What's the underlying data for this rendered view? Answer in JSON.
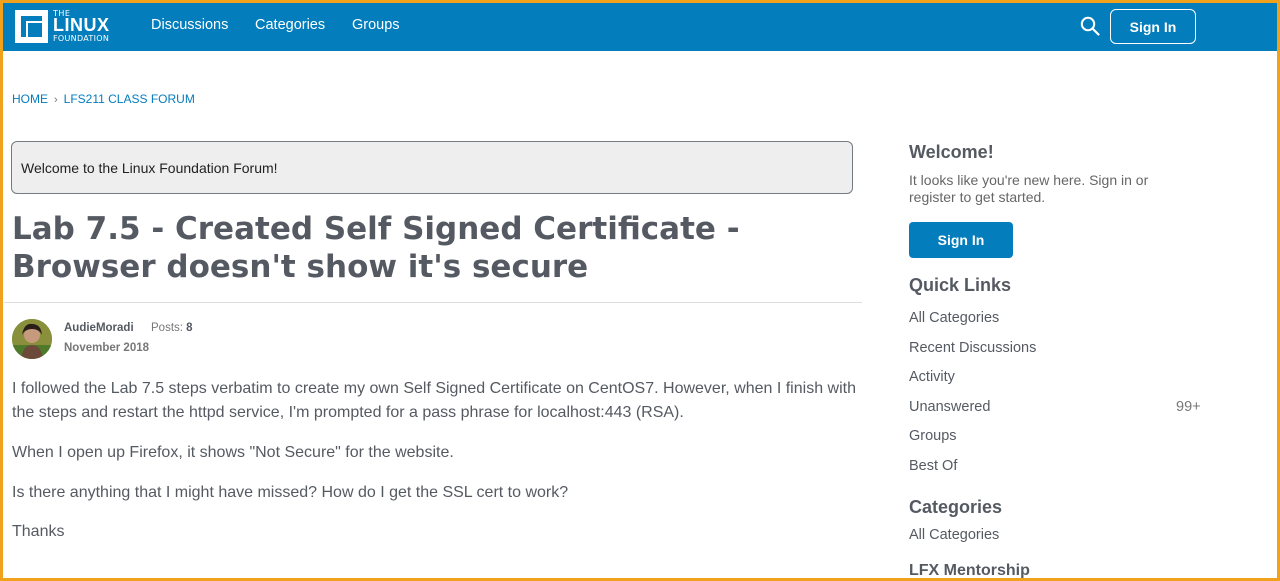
{
  "header": {
    "logo": {
      "the": "THE",
      "linux": "LINUX",
      "foundation": "FOUNDATION"
    },
    "nav": [
      "Discussions",
      "Categories",
      "Groups"
    ],
    "search_icon": "search-icon",
    "signin_label": "Sign In",
    "accent_color": "#037dbc"
  },
  "breadcrumb": {
    "home": "HOME",
    "separator": "›",
    "forum": "LFS211 CLASS FORUM"
  },
  "welcome_banner": "Welcome to the Linux Foundation Forum!",
  "post": {
    "title": "Lab 7.5 - Created Self Signed Certificate - Browser doesn't show it's secure",
    "author": "AudieMoradi",
    "posts_label": "Posts:",
    "posts_count": "8",
    "date": "November 2018",
    "paragraphs": [
      "I followed the Lab 7.5 steps verbatim to create my own Self Signed Certificate on CentOS7. However, when I finish with the steps and restart the httpd service, I'm prompted for a pass phrase for localhost:443 (RSA).",
      "When I open up Firefox, it shows \"Not Secure\" for the website.",
      "Is there anything that I might have missed? How do I get the SSL cert to work?",
      "Thanks"
    ]
  },
  "sidebar": {
    "welcome_heading": "Welcome!",
    "welcome_text": "It looks like you're new here. Sign in or register to get started.",
    "signin_label": "Sign In",
    "quick_links_heading": "Quick Links",
    "quick_links": [
      "All Categories",
      "Recent Discussions",
      "Activity",
      "Unanswered",
      "Groups",
      "Best Of"
    ],
    "unanswered_count": "99+",
    "categories_heading": "Categories",
    "categories": [
      "All Categories",
      "LFX Mentorship"
    ]
  }
}
